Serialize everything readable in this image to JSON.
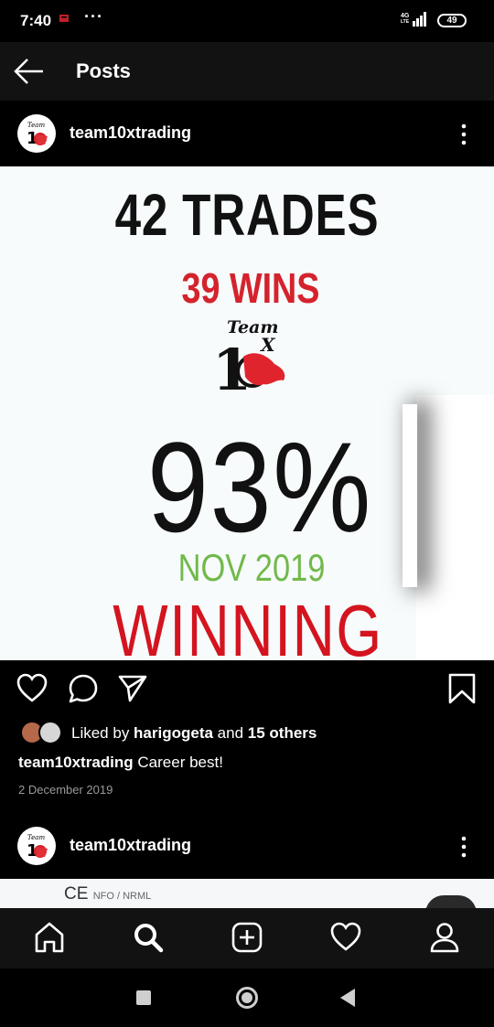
{
  "status_bar": {
    "time": "7:40",
    "dots": "···",
    "network": "4G",
    "network_sub": "LTE",
    "battery": "49"
  },
  "top_bar": {
    "title": "Posts"
  },
  "post": {
    "username": "team10xtrading",
    "image": {
      "line1": "42 TRADES",
      "line2": "39 WINS",
      "logo_text_team": "Team",
      "logo_text_10": "10",
      "logo_text_x": "X",
      "percent": "93%",
      "date": "NOV 2019",
      "winning": "WINNING"
    },
    "liked_prefix": "Liked by ",
    "liked_user": "harigogeta",
    "liked_middle": " and ",
    "liked_others": "15 others",
    "caption_user": "team10xtrading",
    "caption_text": " Career best!",
    "date": "2 December 2019"
  },
  "next_post": {
    "username": "team10xtrading",
    "preview_text": "CE",
    "preview_small": "NFO / NRML"
  },
  "colors": {
    "trades": "#111111",
    "wins": "#d4232d",
    "date": "#71b94a",
    "winning": "#d4141f"
  },
  "icons": {
    "actions": [
      "heart-icon",
      "comment-icon",
      "share-icon",
      "bookmark-icon"
    ],
    "nav": [
      "home-icon",
      "search-icon",
      "add-icon",
      "activity-icon",
      "profile-icon"
    ],
    "system": [
      "recents-icon",
      "home-circle-icon",
      "back-triangle-icon"
    ]
  }
}
